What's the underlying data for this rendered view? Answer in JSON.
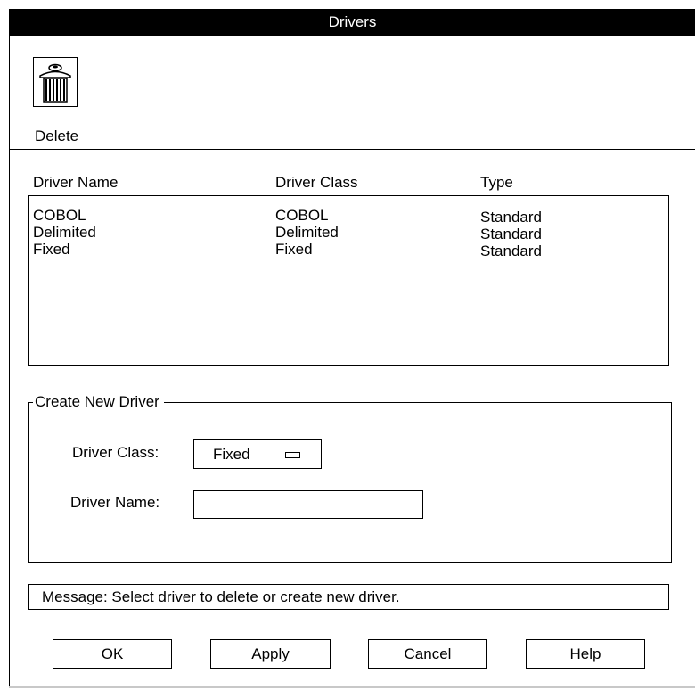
{
  "window": {
    "title": "Drivers"
  },
  "toolbar": {
    "delete_label": "Delete"
  },
  "list": {
    "headers": [
      "Driver Name",
      "Driver Class",
      "Type"
    ],
    "rows": [
      [
        "COBOL",
        "COBOL",
        "Standard"
      ],
      [
        "Delimited",
        "Delimited",
        "Standard"
      ],
      [
        "Fixed",
        "Fixed",
        "Standard"
      ]
    ]
  },
  "create": {
    "group_title": "Create New Driver",
    "class_label": "Driver Class:",
    "class_value": "Fixed",
    "name_label": "Driver Name:",
    "name_value": ""
  },
  "message": "Message: Select driver to delete or create new driver.",
  "buttons": {
    "ok": "OK",
    "apply": "Apply",
    "cancel": "Cancel",
    "help": "Help"
  }
}
